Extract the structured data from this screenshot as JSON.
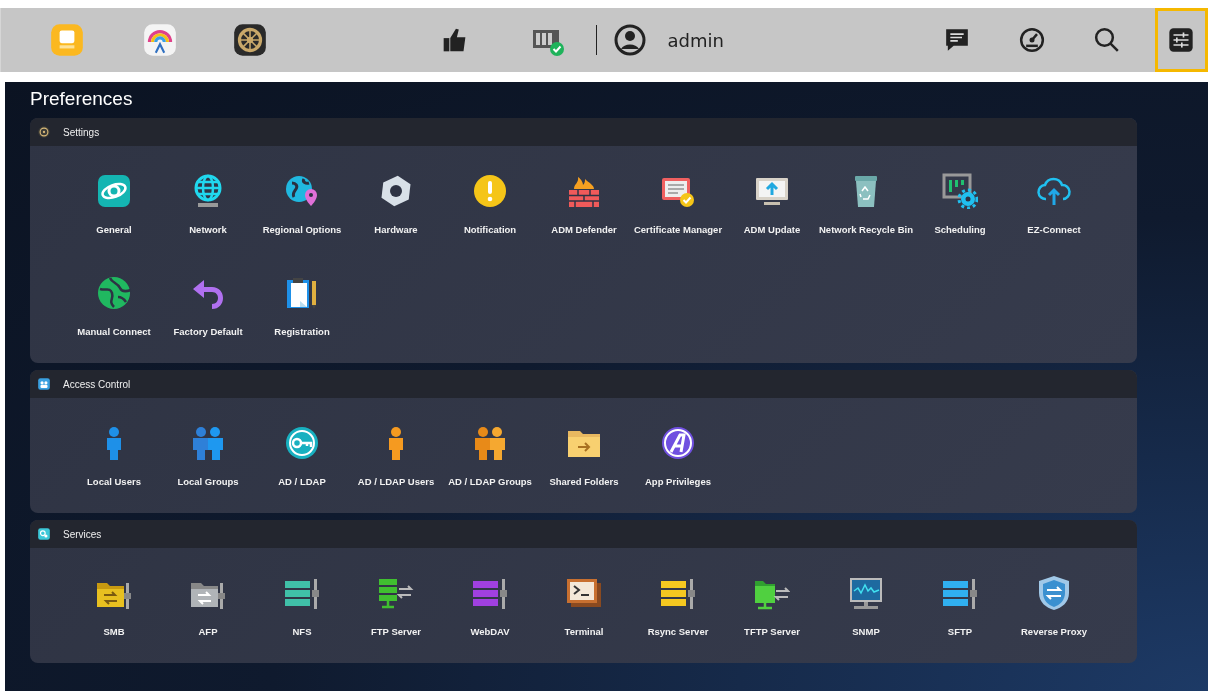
{
  "toolbar": {
    "user": "admin",
    "right_buttons": [
      {
        "selected": false
      },
      {
        "selected": false
      },
      {
        "selected": false
      },
      {
        "selected": true
      }
    ]
  },
  "title": "Preferences",
  "sections": [
    {
      "title": "Settings",
      "items": [
        "General",
        "Network",
        "Regional Options",
        "Hardware",
        "Notification",
        "ADM Defender",
        "Certificate Manager",
        "ADM Update",
        "Network Recycle Bin",
        "Scheduling",
        "EZ-Connect",
        "Manual Connect",
        "Factory Default",
        "Registration"
      ]
    },
    {
      "title": "Access Control",
      "items": [
        "Local Users",
        "Local Groups",
        "AD / LDAP",
        "AD / LDAP Users",
        "AD / LDAP Groups",
        "Shared Folders",
        "App Privileges"
      ]
    },
    {
      "title": "Services",
      "items": [
        "SMB",
        "AFP",
        "NFS",
        "FTP Server",
        "WebDAV",
        "Terminal",
        "Rsync Server",
        "TFTP Server",
        "SNMP",
        "SFTP",
        "Reverse Proxy"
      ]
    }
  ]
}
